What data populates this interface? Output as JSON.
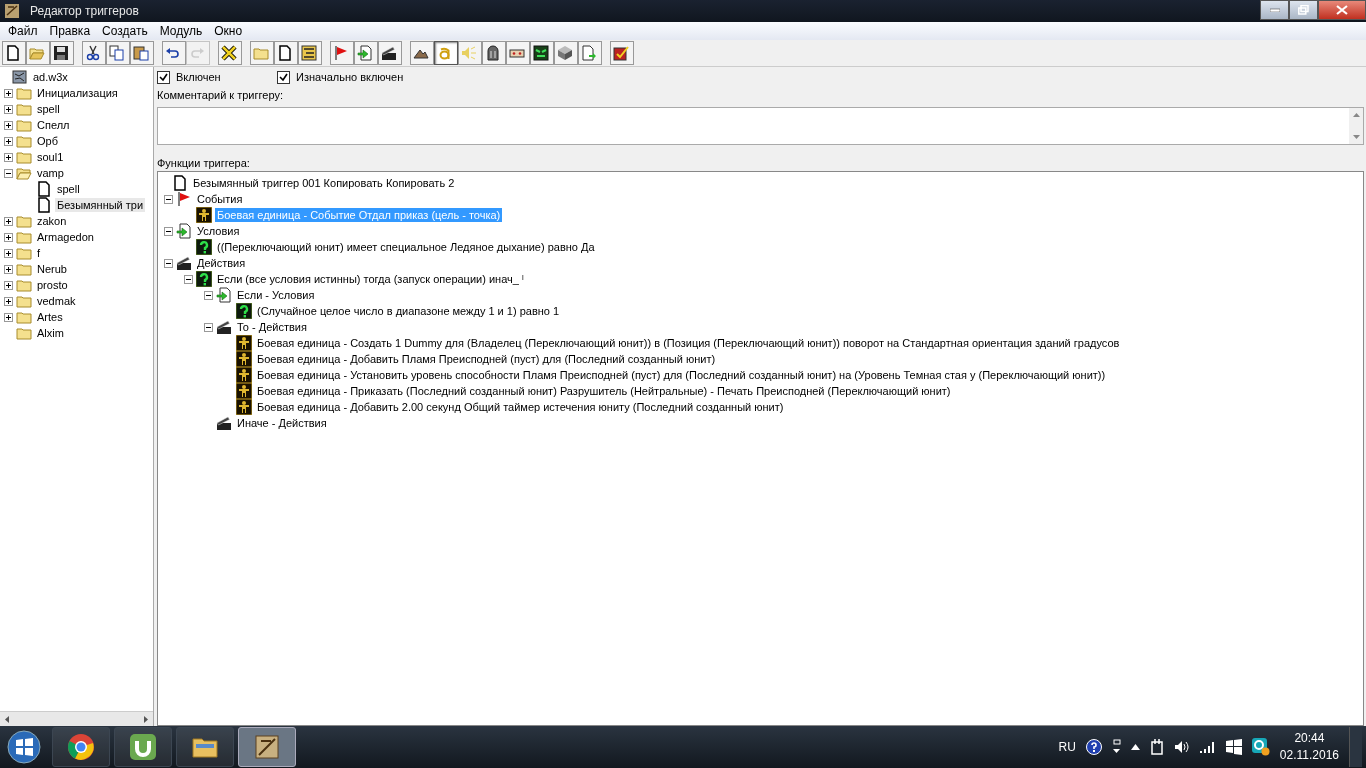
{
  "window": {
    "title": "Редактор триггеров"
  },
  "menu": [
    "Файл",
    "Правка",
    "Создать",
    "Модуль",
    "Окно"
  ],
  "toolbar": [
    [
      {
        "pressed": false,
        "disabled": false
      },
      {
        "pressed": false,
        "disabled": false
      },
      {
        "pressed": false,
        "disabled": false
      }
    ],
    [
      {
        "pressed": false,
        "disabled": false
      },
      {
        "pressed": false,
        "disabled": false
      },
      {
        "pressed": false,
        "disabled": false
      }
    ],
    [
      {
        "pressed": false,
        "disabled": false
      },
      {
        "pressed": false,
        "disabled": true
      }
    ],
    [
      {
        "pressed": false,
        "disabled": false
      }
    ],
    [
      {
        "pressed": false,
        "disabled": false
      },
      {
        "pressed": false,
        "disabled": false
      },
      {
        "pressed": false,
        "disabled": false
      }
    ],
    [
      {
        "pressed": false,
        "disabled": false
      },
      {
        "pressed": false,
        "disabled": false
      },
      {
        "pressed": false,
        "disabled": false
      }
    ],
    [
      {
        "pressed": false,
        "disabled": false
      },
      {
        "pressed": true,
        "disabled": false
      },
      {
        "pressed": false,
        "disabled": false
      },
      {
        "pressed": false,
        "disabled": false
      },
      {
        "pressed": false,
        "disabled": false
      },
      {
        "pressed": false,
        "disabled": false
      },
      {
        "pressed": false,
        "disabled": false
      },
      {
        "pressed": false,
        "disabled": false
      }
    ],
    [
      {
        "pressed": false,
        "disabled": false
      }
    ]
  ],
  "sidebar": {
    "tree": [
      {
        "kind": "map",
        "label": "ad.w3x",
        "selected": false,
        "children": [
          {
            "kind": "folder",
            "label": "Инициализация",
            "expanded": false,
            "selected": false
          },
          {
            "kind": "folder",
            "label": "spell",
            "expanded": false,
            "selected": false
          },
          {
            "kind": "folder",
            "label": "Спелл",
            "expanded": false,
            "selected": false
          },
          {
            "kind": "folder",
            "label": "Орб",
            "expanded": false,
            "selected": false
          },
          {
            "kind": "folder",
            "label": "soul1",
            "expanded": false,
            "selected": false
          },
          {
            "kind": "folder-open",
            "label": "vamp",
            "expanded": true,
            "selected": false,
            "children": [
              {
                "kind": "trigger",
                "label": "spell",
                "selected": false
              },
              {
                "kind": "trigger",
                "label": "Безымянный три",
                "selected": true
              }
            ]
          },
          {
            "kind": "folder",
            "label": "zakon",
            "expanded": false,
            "selected": false
          },
          {
            "kind": "folder",
            "label": "Armagedon",
            "expanded": false,
            "selected": false
          },
          {
            "kind": "folder",
            "label": "f",
            "expanded": false,
            "selected": false
          },
          {
            "kind": "folder",
            "label": "Nerub",
            "expanded": false,
            "selected": false
          },
          {
            "kind": "folder",
            "label": "prosto",
            "expanded": false,
            "selected": false
          },
          {
            "kind": "folder",
            "label": "vedmak",
            "expanded": false,
            "selected": false
          },
          {
            "kind": "folder",
            "label": "Artes",
            "expanded": false,
            "selected": false
          },
          {
            "kind": "folder",
            "label": "Alxim",
            "selected": false
          }
        ]
      }
    ]
  },
  "trigger": {
    "options": [
      {
        "label": "Включен",
        "checked": true
      },
      {
        "label": "Изначально включен",
        "checked": true
      }
    ],
    "comment_label": "Комментарий к триггеру:",
    "functions_label": "Функции триггера:",
    "tree": [
      {
        "kind": "trigger",
        "label": "Безымянный триггер 001 Копировать Копировать 2",
        "selected": false,
        "children": [
          {
            "kind": "event-group",
            "label": "События",
            "expanded": true,
            "selected": false,
            "children": [
              {
                "kind": "unit",
                "label": "Боевая единица - Событие Отдал приказ (цель - точка)",
                "selected": true
              }
            ]
          },
          {
            "kind": "condition-group",
            "label": "Условия",
            "expanded": true,
            "selected": false,
            "children": [
              {
                "kind": "condition",
                "label": "((Переключающий юнит) имеет специальное Ледяное дыхание) равно Да",
                "selected": false
              }
            ]
          },
          {
            "kind": "action-group",
            "label": "Действия",
            "expanded": true,
            "selected": false,
            "children": [
              {
                "kind": "condition",
                "label": "Если (все условия истинны) тогда (запуск операции) инач_ ˡ",
                "expanded": true,
                "selected": false,
                "children": [
                  {
                    "kind": "condition-group",
                    "label": "Если - Условия",
                    "expanded": true,
                    "selected": false,
                    "children": [
                      {
                        "kind": "condition",
                        "label": "(Случайное целое число в диапазоне между 1 и 1) равно 1",
                        "selected": false
                      }
                    ]
                  },
                  {
                    "kind": "action-group",
                    "label": "То - Действия",
                    "expanded": true,
                    "selected": false,
                    "children": [
                      {
                        "kind": "unit",
                        "label": "Боевая единица - Создать 1 Dummy для (Владелец (Переключающий юнит)) в (Позиция (Переключающий юнит)) поворот на Стандартная ориентация зданий градусов",
                        "selected": false
                      },
                      {
                        "kind": "unit",
                        "label": "Боевая единица - Добавить Пламя Преисподней (пуст) для (Последний созданный юнит)",
                        "selected": false
                      },
                      {
                        "kind": "unit",
                        "label": "Боевая единица - Установить уровень способности Пламя Преисподней (пуст) для (Последний созданный юнит) на (Уровень Темная стая  у (Переключающий юнит))",
                        "selected": false
                      },
                      {
                        "kind": "unit",
                        "label": "Боевая единица - Приказать (Последний созданный юнит) Разрушитель (Нейтральные) - Печать Преисподней (Переключающий юнит)",
                        "selected": false
                      },
                      {
                        "kind": "unit",
                        "label": "Боевая единица - Добавить 2.00 секунд Общий таймер истечения юниту (Последний созданный юнит)",
                        "selected": false
                      }
                    ]
                  },
                  {
                    "kind": "action-group",
                    "label": "Иначе - Действия",
                    "selected": false
                  }
                ]
              }
            ]
          }
        ]
      }
    ]
  },
  "taskbar": {
    "apps": [
      {
        "selected": false
      },
      {
        "selected": false
      },
      {
        "selected": false
      },
      {
        "selected": true
      }
    ],
    "language": "RU",
    "time": "20:44",
    "date": "02.11.2016"
  }
}
